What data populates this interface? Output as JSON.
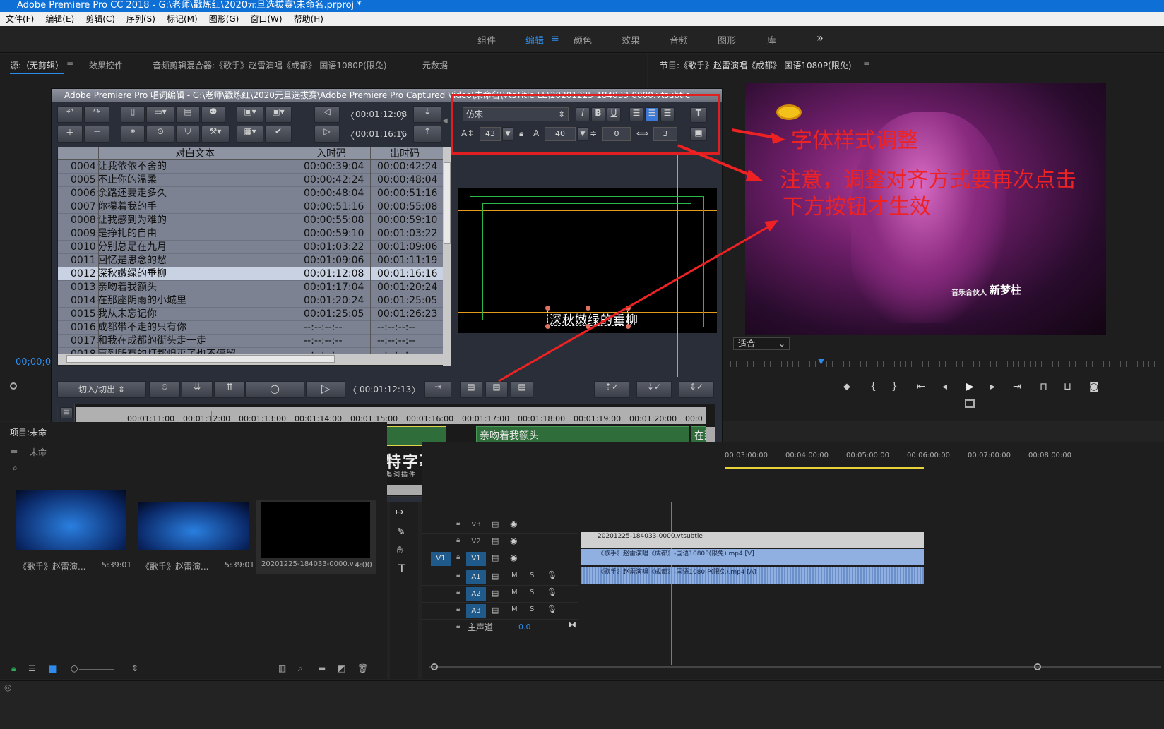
{
  "app": {
    "title": "Adobe Premiere Pro CC 2018 - G:\\老师\\戳炼红\\2020元旦选拔赛\\未命名.prproj *",
    "icon_label": "Pr"
  },
  "menu": [
    "文件(F)",
    "编辑(E)",
    "剪辑(C)",
    "序列(S)",
    "标记(M)",
    "图形(G)",
    "窗口(W)",
    "帮助(H)"
  ],
  "workspaces": {
    "items": [
      "组件",
      "编辑",
      "颜色",
      "效果",
      "音频",
      "图形",
      "库"
    ],
    "active": "编辑",
    "more": "»"
  },
  "source_panel": {
    "tabs": [
      "源:（无剪辑）",
      "效果控件",
      "音频剪辑混合器:《歌手》赵雷演唱《成都》-国语1080P(限免)",
      "元数据"
    ],
    "timecode": "00;00;0"
  },
  "program_panel": {
    "title": "节目:《歌手》赵雷演唱《成都》-国语1080P(限免)",
    "fit": "适合",
    "overlay_text": "音乐合伙人",
    "overlay_name": "新梦柱"
  },
  "dialog": {
    "title": "Adobe Premiere Pro 唱词编辑 - G:\\老师\\戳炼红\\2020元旦选拔赛\\Adobe Premiere Pro Captured Video\\未命名\\VtsTitle LE\\20201225-184033-0000.vtsubtle",
    "tc_in": "00:01:12:08",
    "tc_out": "00:01:16:16",
    "font": "仿宋",
    "font_size": "43",
    "tracking": "40",
    "leading": "0",
    "spacing": "3",
    "table": {
      "headers": [
        "对白文本",
        "入时码",
        "出时码"
      ],
      "rows": [
        [
          "0004",
          "让我依依不舍的",
          "00:00:39:04",
          "00:00:42:24"
        ],
        [
          "0005",
          "不止你的温柔",
          "00:00:42:24",
          "00:00:48:04"
        ],
        [
          "0006",
          "余路还要走多久",
          "00:00:48:04",
          "00:00:51:16"
        ],
        [
          "0007",
          "你攥着我的手",
          "00:00:51:16",
          "00:00:55:08"
        ],
        [
          "0008",
          "让我感到为难的",
          "00:00:55:08",
          "00:00:59:10"
        ],
        [
          "0009",
          "是挣扎的自由",
          "00:00:59:10",
          "00:01:03:22"
        ],
        [
          "0010",
          "分别总是在九月",
          "00:01:03:22",
          "00:01:09:06"
        ],
        [
          "0011",
          "回忆是思念的愁",
          "00:01:09:06",
          "00:01:11:19"
        ],
        [
          "0012",
          "深秋嫩绿的垂柳",
          "00:01:12:08",
          "00:01:16:16"
        ],
        [
          "0013",
          "亲吻着我额头",
          "00:01:17:04",
          "00:01:20:24"
        ],
        [
          "0014",
          "在那座阴雨的小城里",
          "00:01:20:24",
          "00:01:25:05"
        ],
        [
          "0015",
          "我从未忘记你",
          "00:01:25:05",
          "00:01:26:23"
        ],
        [
          "0016",
          "成都带不走的只有你",
          "--:--:--:--",
          "--:--:--:--"
        ],
        [
          "0017",
          "和我在成都的街头走一走",
          "--:--:--:--",
          "--:--:--:--"
        ],
        [
          "0018",
          "直到所有的灯都熄灭了也不停留",
          "--:--:--:--",
          "--:--:--:--"
        ]
      ],
      "selected": "0012"
    },
    "preview_text": "深秋嫩绿的垂柳",
    "mode": "切入/切出",
    "play_tc": "00:01:12:13",
    "ruler": [
      "00:01:11:00",
      "00:01:12:00",
      "00:01:13:00",
      "00:01:14:00",
      "00:01:15:00",
      "00:01:16:00",
      "00:01:17:00",
      "00:01:18:00",
      "00:01:19:00",
      "00:01:20:00",
      "00:0"
    ],
    "clips": [
      "念的愁",
      "深秋嫩绿的垂柳",
      "亲吻着我额头",
      "在那"
    ],
    "logo_text": "雷特字幕",
    "logo_sub": "免费唱词插件"
  },
  "annotations": {
    "a1": "字体样式调整",
    "a2_line1": "注意，调整对齐方式要再次点击",
    "a2_line2": "下方按钮才生效"
  },
  "project": {
    "tab": "项目:未命",
    "folder": "未命",
    "items": [
      {
        "name": "《歌手》赵雷演...",
        "dur": "5:39:01"
      },
      {
        "name": "《歌手》赵雷演...",
        "dur": "5:39:01"
      },
      {
        "name": "20201225-184033-0000.vt...",
        "dur": "4:00"
      }
    ]
  },
  "timeline": {
    "ruler": [
      "00:03:00:00",
      "00:04:00:00",
      "00:05:00:00",
      "00:06:00:00",
      "00:07:00:00",
      "00:08:00:00"
    ],
    "tracks": [
      "V3",
      "V2",
      "V1",
      "A1",
      "A2",
      "A3"
    ],
    "v1_src": "V1",
    "master": "主声道",
    "master_val": "0.0",
    "clip_v2": "20201225-184033-0000.vtsubtle",
    "clip_v1": "《歌手》赵雷演唱《成都》-国语1080P(限免).mp4 [V]",
    "clip_a1": "《歌手》赵雷演唱《成都》-国语1080 P(限免).mp4 [A]",
    "m": "M",
    "s": "S"
  }
}
